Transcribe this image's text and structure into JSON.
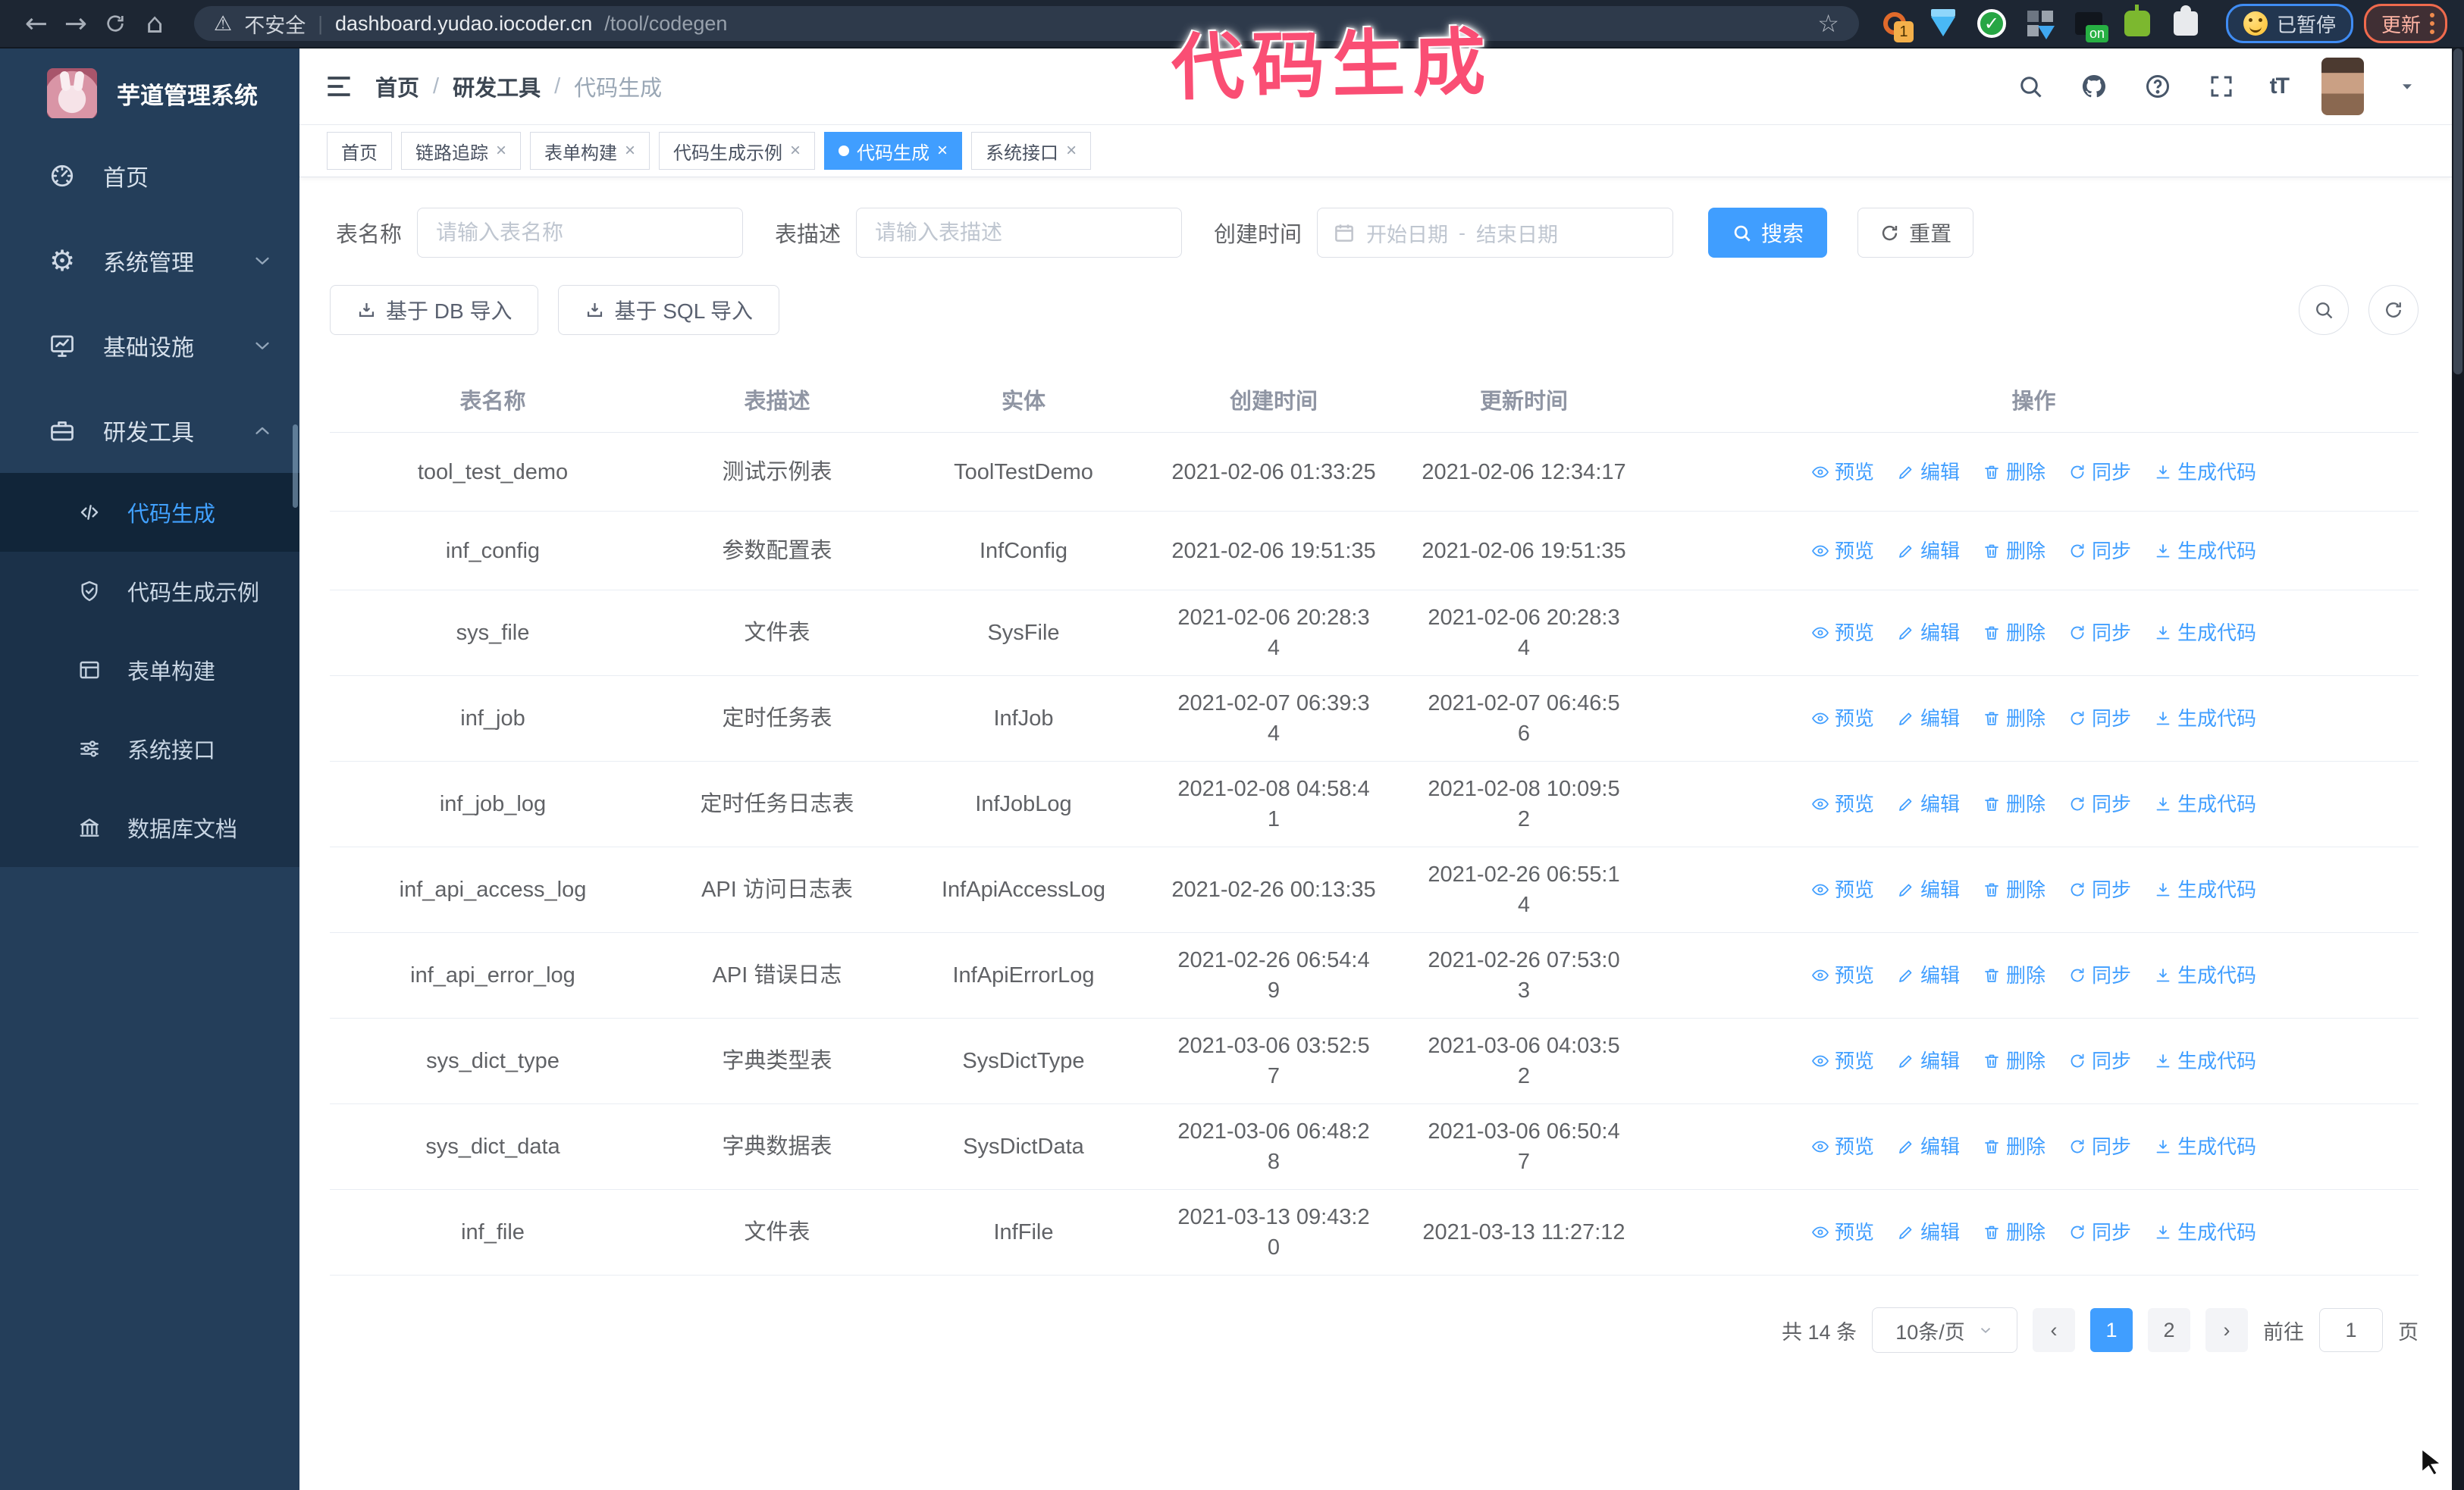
{
  "browser": {
    "security": "不安全",
    "url_host": "dashboard.yudao.iocoder.cn",
    "url_path": "/tool/codegen",
    "ext_badge": "1",
    "ext_on": "on",
    "paused_label": "已暂停",
    "update_label": "更新"
  },
  "icons": {
    "back": "←",
    "forward": "→",
    "home": "⌂",
    "warning": "⚠",
    "star": "☆",
    "gear": "⚙",
    "close": "×",
    "separator": "|",
    "font_size": "tT"
  },
  "annotation": {
    "text": "代码生成",
    "color": "#fa4e74"
  },
  "sidebar": {
    "logo_title": "芋道管理系统",
    "items": [
      {
        "name": "home",
        "label": "首页",
        "icon": "dashboard-icon",
        "chevron": ""
      },
      {
        "name": "system-mgmt",
        "label": "系统管理",
        "icon": "gear-icon",
        "chevron": "down"
      },
      {
        "name": "infrastructure",
        "label": "基础设施",
        "icon": "monitor-icon",
        "chevron": "down"
      },
      {
        "name": "dev-tools",
        "label": "研发工具",
        "icon": "toolbox-icon",
        "chevron": "up"
      }
    ],
    "submenu": [
      {
        "name": "codegen",
        "label": "代码生成",
        "icon": "code-icon",
        "active": true
      },
      {
        "name": "codegen-demo",
        "label": "代码生成示例",
        "icon": "shield-check-icon",
        "active": false
      },
      {
        "name": "form-builder",
        "label": "表单构建",
        "icon": "form-icon",
        "active": false
      },
      {
        "name": "system-api",
        "label": "系统接口",
        "icon": "sliders-icon",
        "active": false
      },
      {
        "name": "db-doc",
        "label": "数据库文档",
        "icon": "db-icon",
        "active": false
      }
    ]
  },
  "topbar": {
    "breadcrumb": [
      "首页",
      "研发工具",
      "代码生成"
    ]
  },
  "tabs": [
    {
      "label": "首页",
      "closable": false,
      "active": false
    },
    {
      "label": "链路追踪",
      "closable": true,
      "active": false
    },
    {
      "label": "表单构建",
      "closable": true,
      "active": false
    },
    {
      "label": "代码生成示例",
      "closable": true,
      "active": false
    },
    {
      "label": "代码生成",
      "closable": true,
      "active": true
    },
    {
      "label": "系统接口",
      "closable": true,
      "active": false
    }
  ],
  "filters": {
    "name_label": "表名称",
    "name_placeholder": "请输入表名称",
    "desc_label": "表描述",
    "desc_placeholder": "请输入表描述",
    "time_label": "创建时间",
    "start_placeholder": "开始日期",
    "range_separator": "-",
    "end_placeholder": "结束日期",
    "search_label": "搜索",
    "reset_label": "重置"
  },
  "toolbar": {
    "import_db_label": "基于 DB 导入",
    "import_sql_label": "基于 SQL 导入"
  },
  "table": {
    "columns": [
      "表名称",
      "表描述",
      "实体",
      "创建时间",
      "更新时间",
      "操作"
    ],
    "actions": [
      {
        "label": "预览",
        "icon": "eye-icon"
      },
      {
        "label": "编辑",
        "icon": "edit-icon"
      },
      {
        "label": "删除",
        "icon": "delete-icon"
      },
      {
        "label": "同步",
        "icon": "sync-icon"
      },
      {
        "label": "生成代码",
        "icon": "download-icon"
      }
    ],
    "rows": [
      {
        "name": "tool_test_demo",
        "desc": "测试示例表",
        "entity": "ToolTestDemo",
        "created": [
          "2021-02-06 01:33:25"
        ],
        "updated": [
          "2021-02-06 12:34:17"
        ]
      },
      {
        "name": "inf_config",
        "desc": "参数配置表",
        "entity": "InfConfig",
        "created": [
          "2021-02-06 19:51:35"
        ],
        "updated": [
          "2021-02-06 19:51:35"
        ]
      },
      {
        "name": "sys_file",
        "desc": "文件表",
        "entity": "SysFile",
        "created": [
          "2021-02-06 20:28:3",
          "4"
        ],
        "updated": [
          "2021-02-06 20:28:3",
          "4"
        ]
      },
      {
        "name": "inf_job",
        "desc": "定时任务表",
        "entity": "InfJob",
        "created": [
          "2021-02-07 06:39:3",
          "4"
        ],
        "updated": [
          "2021-02-07 06:46:5",
          "6"
        ]
      },
      {
        "name": "inf_job_log",
        "desc": "定时任务日志表",
        "entity": "InfJobLog",
        "created": [
          "2021-02-08 04:58:4",
          "1"
        ],
        "updated": [
          "2021-02-08 10:09:5",
          "2"
        ]
      },
      {
        "name": "inf_api_access_log",
        "desc": "API 访问日志表",
        "entity": "InfApiAccessLog",
        "created": [
          "2021-02-26 00:13:35"
        ],
        "updated": [
          "2021-02-26 06:55:1",
          "4"
        ]
      },
      {
        "name": "inf_api_error_log",
        "desc": "API 错误日志",
        "entity": "InfApiErrorLog",
        "created": [
          "2021-02-26 06:54:4",
          "9"
        ],
        "updated": [
          "2021-02-26 07:53:0",
          "3"
        ]
      },
      {
        "name": "sys_dict_type",
        "desc": "字典类型表",
        "entity": "SysDictType",
        "created": [
          "2021-03-06 03:52:5",
          "7"
        ],
        "updated": [
          "2021-03-06 04:03:5",
          "2"
        ]
      },
      {
        "name": "sys_dict_data",
        "desc": "字典数据表",
        "entity": "SysDictData",
        "created": [
          "2021-03-06 06:48:2",
          "8"
        ],
        "updated": [
          "2021-03-06 06:50:4",
          "7"
        ]
      },
      {
        "name": "inf_file",
        "desc": "文件表",
        "entity": "InfFile",
        "created": [
          "2021-03-13 09:43:2",
          "0"
        ],
        "updated": [
          "2021-03-13 11:27:12"
        ]
      }
    ]
  },
  "pagination": {
    "total": "共 14 条",
    "page_size": "10条/页",
    "prev": "‹",
    "next": "›",
    "pages": [
      "1",
      "2"
    ],
    "active_page": "1",
    "goto_label": "前往",
    "goto_value": "1",
    "page_unit": "页"
  }
}
